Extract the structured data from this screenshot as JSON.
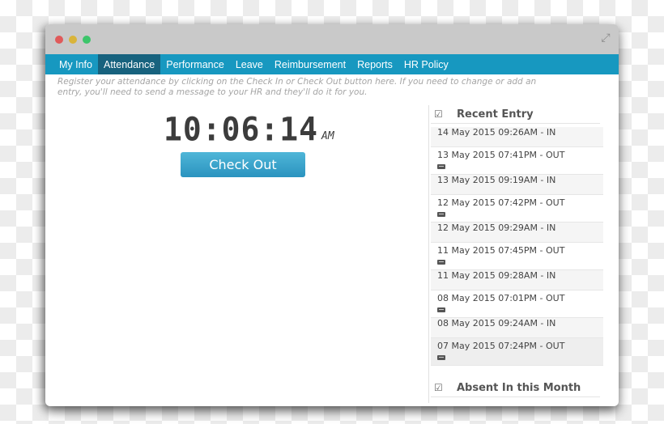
{
  "window": {
    "controls": [
      "close",
      "minimize",
      "zoom"
    ],
    "expand_icon": "expand-arrows-icon"
  },
  "nav": {
    "items": [
      {
        "label": "My Info",
        "active": false
      },
      {
        "label": "Attendance",
        "active": true
      },
      {
        "label": "Performance",
        "active": false
      },
      {
        "label": "Leave",
        "active": false
      },
      {
        "label": "Reimbursement",
        "active": false
      },
      {
        "label": "Reports",
        "active": false
      },
      {
        "label": "HR Policy",
        "active": false
      }
    ]
  },
  "intro": "Register your attendance by clicking on the Check In or Check Out button here. If you need to change or add an entry, you'll need to send a message to your HR and they'll do it for you.",
  "clock": {
    "time": "10:06:14",
    "ampm": "AM"
  },
  "checkout_button": "Check Out",
  "recent": {
    "title": "Recent Entry",
    "entries": [
      {
        "text": "14 May 2015 09:26AM - IN",
        "type": "in"
      },
      {
        "text": "13 May 2015 07:41PM - OUT",
        "type": "out"
      },
      {
        "text": "13 May 2015 09:19AM - IN",
        "type": "in"
      },
      {
        "text": "12 May 2015 07:42PM - OUT",
        "type": "out"
      },
      {
        "text": "12 May 2015 09:29AM - IN",
        "type": "in"
      },
      {
        "text": "11 May 2015 07:45PM - OUT",
        "type": "out"
      },
      {
        "text": "11 May 2015 09:28AM - IN",
        "type": "in"
      },
      {
        "text": "08 May 2015 07:01PM - OUT",
        "type": "out"
      },
      {
        "text": "08 May 2015 09:24AM - IN",
        "type": "in"
      },
      {
        "text": "07 May 2015 07:24PM - OUT",
        "type": "out"
      }
    ]
  },
  "absent": {
    "title": "Absent In this Month"
  },
  "colors": {
    "nav_bg": "#1798c0",
    "nav_active": "#17627e",
    "button": "#3aa5cc"
  }
}
